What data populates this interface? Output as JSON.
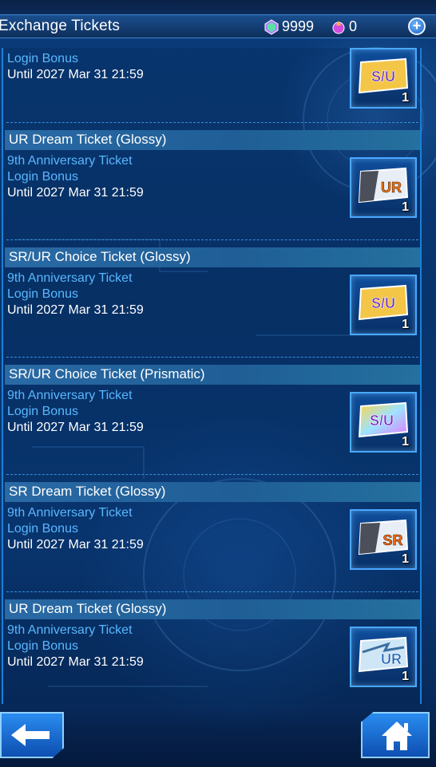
{
  "header": {
    "title": "Exchange Tickets",
    "gems": "9999",
    "tickets_currency": "0",
    "plus_label": "+"
  },
  "partial_ticket": {
    "line2": "Login Bonus",
    "line3": "Until 2027 Mar 31 21:59",
    "icon": "su-ticket-icon",
    "qty": "1",
    "icon_text": "S/U"
  },
  "tickets": [
    {
      "title": "UR Dream Ticket (Glossy)",
      "line1": "9th Anniversary Ticket",
      "line2": "Login Bonus",
      "line3": "Until 2027 Mar 31 21:59",
      "icon": "ur-ticket-icon",
      "icon_text": "UR",
      "qty": "1"
    },
    {
      "title": "SR/UR Choice Ticket (Glossy)",
      "line1": "9th Anniversary Ticket",
      "line2": "Login Bonus",
      "line3": "Until 2027 Mar 31 21:59",
      "icon": "su-ticket-icon",
      "icon_text": "S/U",
      "qty": "1"
    },
    {
      "title": "SR/UR Choice Ticket (Prismatic)",
      "line1": "9th Anniversary Ticket",
      "line2": "Login Bonus",
      "line3": "Until 2027 Mar 31 21:59",
      "icon": "su-prismatic-ticket-icon",
      "icon_text": "S/U",
      "qty": "1"
    },
    {
      "title": "SR Dream Ticket (Glossy)",
      "line1": "9th Anniversary Ticket",
      "line2": "Login Bonus",
      "line3": "Until 2027 Mar 31 21:59",
      "icon": "sr-ticket-icon",
      "icon_text": "SR",
      "qty": "1"
    },
    {
      "title": "UR Dream Ticket (Glossy)",
      "line1": "9th Anniversary Ticket",
      "line2": "Login Bonus",
      "line3": "Until 2027 Mar 31 21:59",
      "icon": "ur-ticket-icon",
      "icon_text": "UR",
      "qty": "1"
    }
  ],
  "colors": {
    "accent_blue": "#59b7ff",
    "title_bar": "#2a6aa5",
    "border": "#4aa8ff"
  },
  "nav": {
    "back_icon": "back-arrow-icon",
    "home_icon": "home-icon"
  }
}
